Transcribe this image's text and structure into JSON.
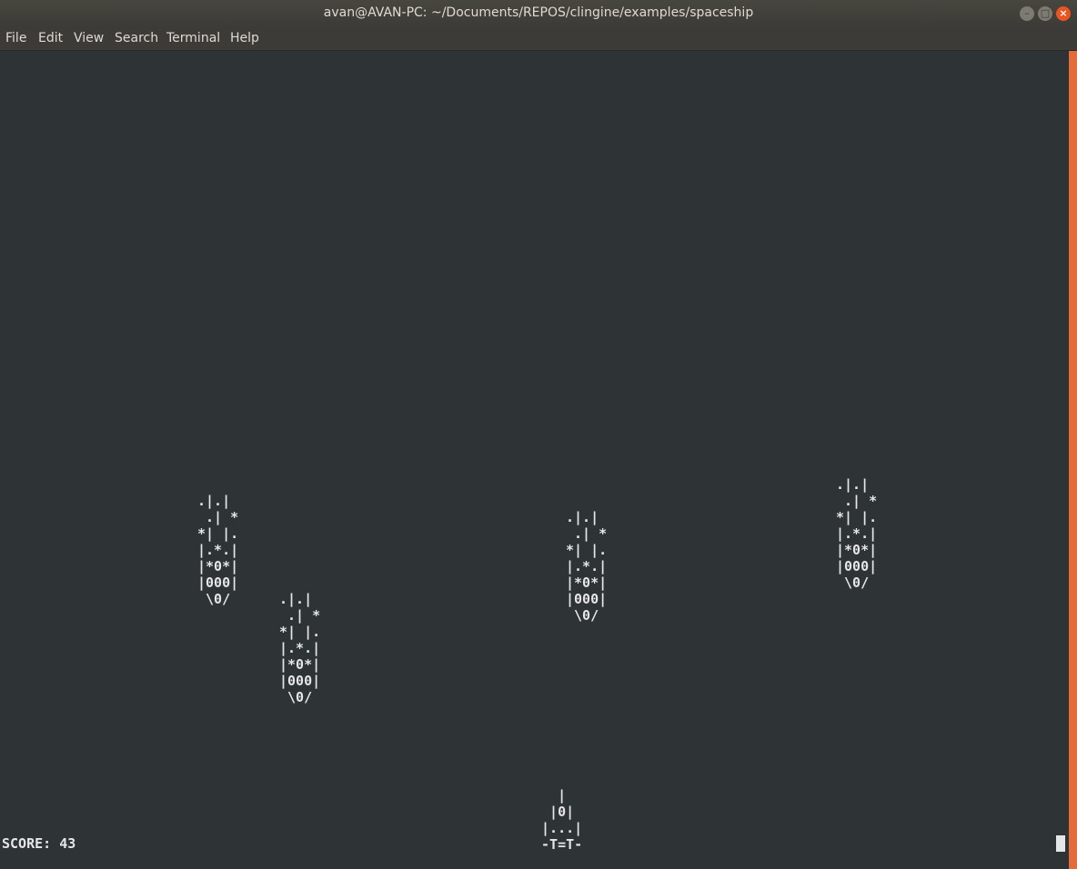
{
  "window": {
    "title": "avan@AVAN-PC: ~/Documents/REPOS/clingine/examples/spaceship",
    "buttons": {
      "minimize": "–",
      "maximize": "□",
      "close": "×"
    }
  },
  "menu": {
    "file": "File",
    "edit": "Edit",
    "view": "View",
    "search": "Search",
    "terminal": "Terminal",
    "help": "Help"
  },
  "game": {
    "enemies": [
      {
        "sprite": ".|.|\n .| *\n*| |.\n|.*.|\n|*0*|\n|000|\n \\0/"
      },
      {
        "sprite": ".|.|\n .| *\n*| |.\n|.*.|\n|*0*|\n|000|\n \\0/"
      },
      {
        "sprite": ".|.|\n .| *\n*| |.\n|.*.|\n|*0*|\n|000|\n \\0/"
      },
      {
        "sprite": ".|.|\n .| *\n*| |.\n|.*.|\n|*0*|\n|000|\n \\0/"
      }
    ],
    "player": {
      "sprite": "   |\n  |0|\n |...|\n -T=T-"
    },
    "score_text": "SCORE: 43"
  },
  "colors": {
    "terminal_bg": "#2e3436",
    "terminal_fg": "#e6e6e6",
    "scrollbar_accent": "#e36b3c",
    "close_button": "#e9541f"
  }
}
